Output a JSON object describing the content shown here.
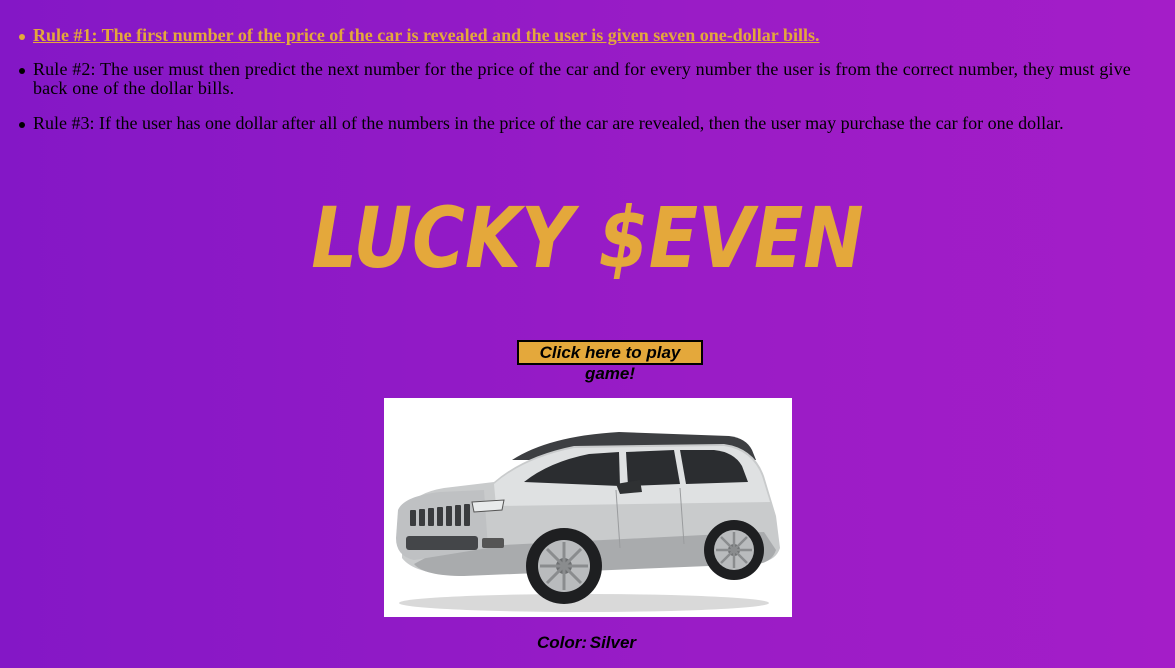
{
  "rules": [
    {
      "label": "Rule #1: The first number of the price of the car is revealed and the user is given seven one-dollar bills."
    },
    {
      "label": "Rule #2: The user must then predict the next number for the price of the car and for every number the user is from the correct number, they must give back one of the dollar bills."
    },
    {
      "label": "Rule #3: If the user has one dollar after all of the numbers in the price of the car are revealed, then the user may purchase the car for one dollar."
    }
  ],
  "title": "LUCKY $EVEN",
  "play_button": {
    "label": "Click here to play game!"
  },
  "car": {
    "icon": "car-image",
    "color_label": "Color:",
    "color_value": "Silver"
  },
  "colors": {
    "background": "#9a1cc6",
    "accent": "#e4a83b"
  }
}
